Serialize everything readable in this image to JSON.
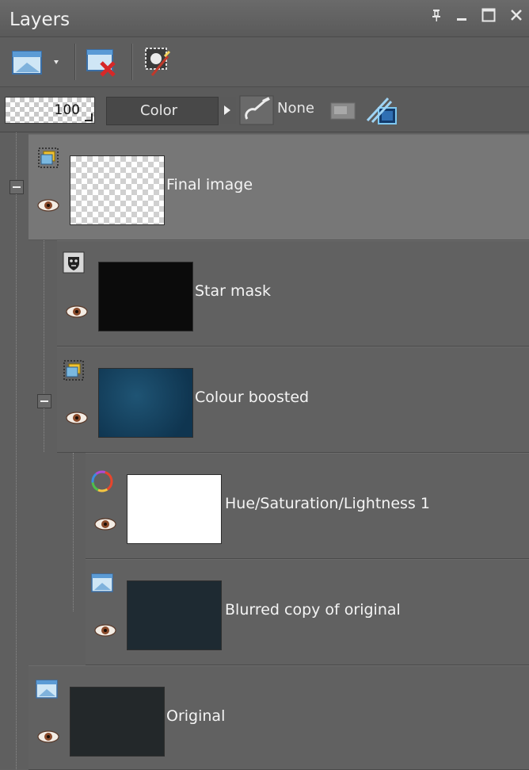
{
  "window": {
    "title": "Layers",
    "controls": [
      "pin-icon",
      "minimize-icon",
      "maximize-icon",
      "close-icon"
    ]
  },
  "toolbar": {
    "new_layer_icon": "new-raster-layer-icon",
    "delete_layer_icon": "delete-layer-icon",
    "mask_icon": "new-mask-icon"
  },
  "properties": {
    "opacity": "100",
    "blend_mode": "Color",
    "link_mode": "None"
  },
  "layers": [
    {
      "name": "Final image",
      "type": "layer-group",
      "thumb": "transparent",
      "selected": true
    },
    {
      "name": "Star mask",
      "type": "mask",
      "thumb": "black"
    },
    {
      "name": "Colour boosted",
      "type": "layer-group",
      "thumb": "teal"
    },
    {
      "name": "Hue/Saturation/Lightness 1",
      "type": "adjustment",
      "thumb": "white"
    },
    {
      "name": "Blurred copy of original",
      "type": "raster",
      "thumb": "dark"
    },
    {
      "name": "Original",
      "type": "raster",
      "thumb": "dark"
    }
  ],
  "colors": {
    "panel_bg": "#5f5f5f",
    "selected_row": "#777777",
    "text": "#f4f4f4"
  }
}
